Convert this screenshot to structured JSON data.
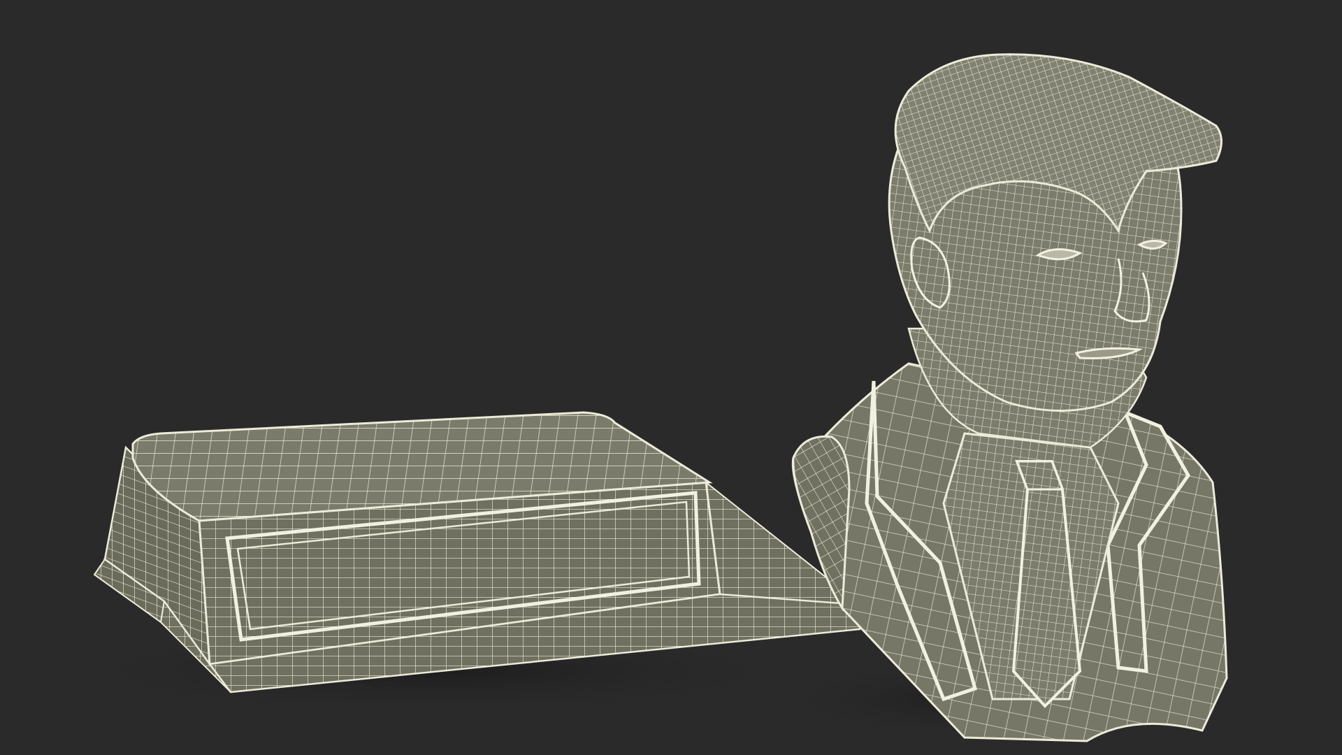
{
  "scene": {
    "objects": [
      {
        "name": "pedestal-base",
        "render": "wireframe"
      },
      {
        "name": "bust",
        "render": "wireframe"
      }
    ]
  },
  "colors": {
    "background": "#2a2a2a",
    "mesh_fill": "#7a7b6a",
    "mesh_fill_dark": "#5f604f",
    "wire": "#ecebd9",
    "shadow": "#1e1e1e"
  }
}
